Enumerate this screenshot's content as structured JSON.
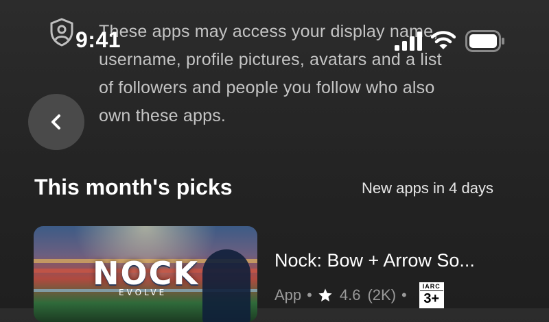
{
  "description": {
    "lines": [
      "These apps may access your display name,",
      "username, profile pictures, avatars and a list",
      "of followers and people you follow who also",
      "own these apps."
    ]
  },
  "status_bar": {
    "time": "9:41"
  },
  "section": {
    "title": "This month's picks",
    "note": "New apps in 4 days"
  },
  "apps": [
    {
      "thumbnail_logo": "NOCK",
      "thumbnail_sub": "EVOLVE",
      "name": "Nock: Bow + Arrow So...",
      "type": "App",
      "rating": "4.6",
      "rating_count": "(2K)",
      "age_rating_org": "IARC",
      "age_rating": "3+"
    }
  ],
  "icons": {
    "shield": "shield-user-icon",
    "back": "chevron-left-icon",
    "signal": "cellular-signal-icon",
    "wifi": "wifi-icon",
    "battery": "battery-icon",
    "star": "star-icon"
  },
  "colors": {
    "background": "#2a2a2a",
    "text_primary": "#ffffff",
    "text_secondary": "#c4c4c4",
    "text_muted": "#9a9a9a",
    "button_bg": "#4a4a4a"
  }
}
